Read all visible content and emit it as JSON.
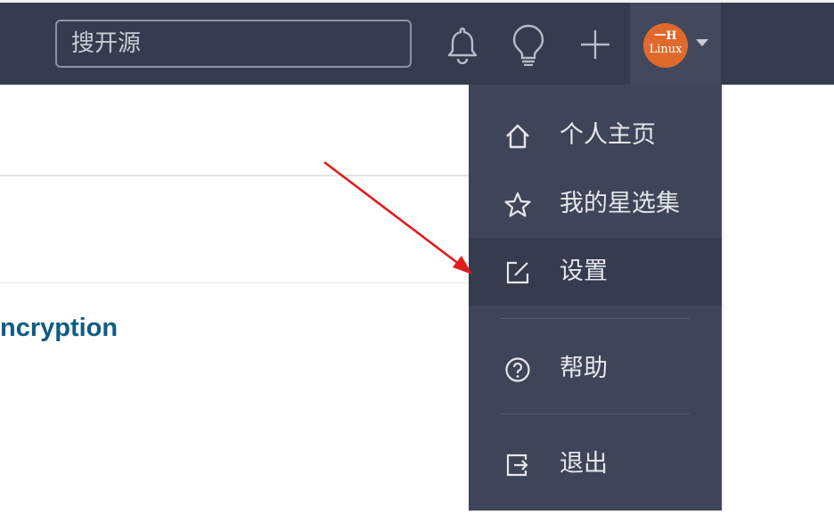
{
  "search": {
    "placeholder": "搜开源"
  },
  "header": {
    "notifications_icon": "bell-icon",
    "ideas_icon": "lightbulb-icon",
    "create_icon": "plus-icon",
    "avatar": {
      "line1": "一H",
      "line2": "Linux",
      "color": "#e06a2c"
    }
  },
  "content": {
    "heading": "ncryption"
  },
  "user_menu": {
    "items": [
      {
        "label": "个人主页",
        "icon": "home-icon"
      },
      {
        "label": "我的星选集",
        "icon": "star-icon"
      },
      {
        "label": "设置",
        "icon": "edit-icon",
        "active": true
      },
      {
        "label": "帮助",
        "icon": "help-circle-icon"
      },
      {
        "label": "退出",
        "icon": "logout-icon"
      }
    ]
  },
  "annotation": {
    "color": "#e31b1b"
  }
}
